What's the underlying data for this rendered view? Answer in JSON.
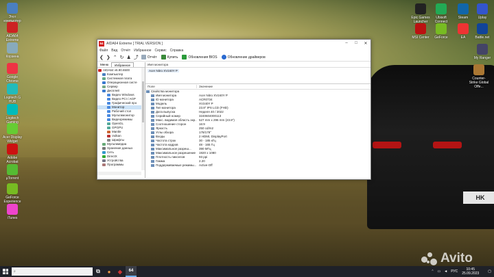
{
  "desktop_left": [
    {
      "label": "Этот компьютер",
      "color": "#4a7fbf"
    },
    {
      "label": "AIDA64 Extreme",
      "color": "#c22"
    },
    {
      "label": "Корзина",
      "color": "#8ab"
    },
    {
      "label": "Google Chrome",
      "color": "#e34"
    },
    {
      "label": "Logitech G HUB",
      "color": "#2bb"
    },
    {
      "label": "Logitech Gaming",
      "color": "#0bb"
    },
    {
      "label": "Acer Display Widget",
      "color": "#6c3"
    },
    {
      "label": "Adobe Acrobat",
      "color": "#c11"
    },
    {
      "label": "µTorrent",
      "color": "#5b3"
    },
    {
      "label": "GeForce Experience",
      "color": "#7b2"
    },
    {
      "label": "iTunes",
      "color": "#e4c"
    }
  ],
  "desktop_right": [
    {
      "label": "Epic Games Launcher",
      "color": "#222"
    },
    {
      "label": "Ubisoft Connect",
      "color": "#2a5"
    },
    {
      "label": "Steam",
      "color": "#16a"
    },
    {
      "label": "Uplay",
      "color": "#35c"
    },
    {
      "label": "MSI Center",
      "color": "#b11"
    },
    {
      "label": "GeForce",
      "color": "#7b2"
    },
    {
      "label": "EA",
      "color": "#e33"
    },
    {
      "label": "Battle.net",
      "color": "#149"
    },
    {
      "label": "My Ranger",
      "color": "#446"
    },
    {
      "label": "Counter-Strike Global Offe...",
      "color": "#a73"
    }
  ],
  "window": {
    "title": "AIDA64 Extreme  [ TRIAL VERSION ]",
    "menu": [
      "Файл",
      "Вид",
      "Отчёт",
      "Избранное",
      "Сервис",
      "Справка"
    ],
    "toolbar": {
      "report": "Отчёт",
      "buy": "Купить",
      "bios": "Обновления BIOS",
      "drivers": "Обновление драйверов"
    },
    "left_tabs": [
      "Меню",
      "Избранное"
    ],
    "tree": [
      {
        "label": "AIDA64 v6.90.6500",
        "color": "#c22"
      },
      {
        "label": "Компьютер",
        "color": "#4a7fbf"
      },
      {
        "label": "Системная плата",
        "color": "#6a8"
      },
      {
        "label": "Операционная систе",
        "color": "#3a7ad0"
      },
      {
        "label": "Сервер",
        "color": "#7a8"
      },
      {
        "label": "Дисплей",
        "color": "#3b7bd0"
      },
      {
        "label": "Видео Windows",
        "color": "#4a8ae0"
      },
      {
        "label": "Видео PCI / AGP",
        "color": "#4a8ae0"
      },
      {
        "label": "Графический про",
        "color": "#4a8ae0"
      },
      {
        "label": "Монитор",
        "color": "#4a8ae0",
        "selected": true
      },
      {
        "label": "Рабочий стол",
        "color": "#4a8ae0"
      },
      {
        "label": "Мультимонитор",
        "color": "#4a8ae0"
      },
      {
        "label": "Видеорежимы",
        "color": "#4a8ae0"
      },
      {
        "label": "OpenGL",
        "color": "#5a9"
      },
      {
        "label": "GPGPU",
        "color": "#5a9"
      },
      {
        "label": "Mantle",
        "color": "#c63"
      },
      {
        "label": "Vulkan",
        "color": "#b33"
      },
      {
        "label": "Шрифты",
        "color": "#888"
      },
      {
        "label": "Мультимедиа",
        "color": "#6a7"
      },
      {
        "label": "Хранение данных",
        "color": "#777"
      },
      {
        "label": "Сеть",
        "color": "#39c"
      },
      {
        "label": "DirectX",
        "color": "#3a3"
      },
      {
        "label": "Устройства",
        "color": "#778"
      },
      {
        "label": "Программы",
        "color": "#a77"
      }
    ],
    "monitor_header": "Имя монитора",
    "monitor_name": "Acer Nitro XV240Y P",
    "columns": {
      "field": "Поле",
      "value": "Значение"
    },
    "rows": [
      {
        "field": "Свойства монитора",
        "value": "",
        "group": true
      },
      {
        "field": "Имя монитора",
        "value": "Acer Nitro XV240Y P"
      },
      {
        "field": "ID монитора",
        "value": "ACR0734"
      },
      {
        "field": "Модель",
        "value": "XV240Y P"
      },
      {
        "field": "Тип монитора",
        "value": "23.8\" IPS LCD (FHD)"
      },
      {
        "field": "Дата выпуска",
        "value": "Неделя 40 / 2022"
      },
      {
        "field": "Серийный номер",
        "value": "3240604000113"
      },
      {
        "field": "Макс. видимая область экр...",
        "value": "527 mm x 296 mm (23.8\")"
      },
      {
        "field": "Соотношение сторон",
        "value": "16:9"
      },
      {
        "field": "Яркость",
        "value": "250 cd/m2"
      },
      {
        "field": "Углы обзора",
        "value": "178/178°"
      },
      {
        "field": "Входы",
        "value": "2 HDMI, DisplayPort"
      },
      {
        "field": "Частота строк",
        "value": "30 - 185 кГц"
      },
      {
        "field": "Частота кадров",
        "value": "48 - 165 Гц"
      },
      {
        "field": "Максимальное разреш...",
        "value": "390 МГц"
      },
      {
        "field": "Максимальное разрешение",
        "value": "1920 x 1080"
      },
      {
        "field": "Плотность пикселов",
        "value": "93 ppi"
      },
      {
        "field": "Гамма",
        "value": "2.20"
      },
      {
        "field": "Поддерживаемые режимы...",
        "value": "Active-Off"
      }
    ]
  },
  "taskbar": {
    "search_placeholder": "",
    "apps": [
      {
        "name": "task-view",
        "glyph": "⧉",
        "color": "#ddd"
      },
      {
        "name": "chrome",
        "glyph": "●",
        "color": "#e94"
      },
      {
        "name": "media",
        "glyph": "◆",
        "color": "#c33"
      },
      {
        "name": "aida64",
        "glyph": "64",
        "color": "#fff"
      }
    ],
    "lang": "РУС",
    "time": "10:45",
    "date": "25.09.2023"
  },
  "watermark": "Avito"
}
